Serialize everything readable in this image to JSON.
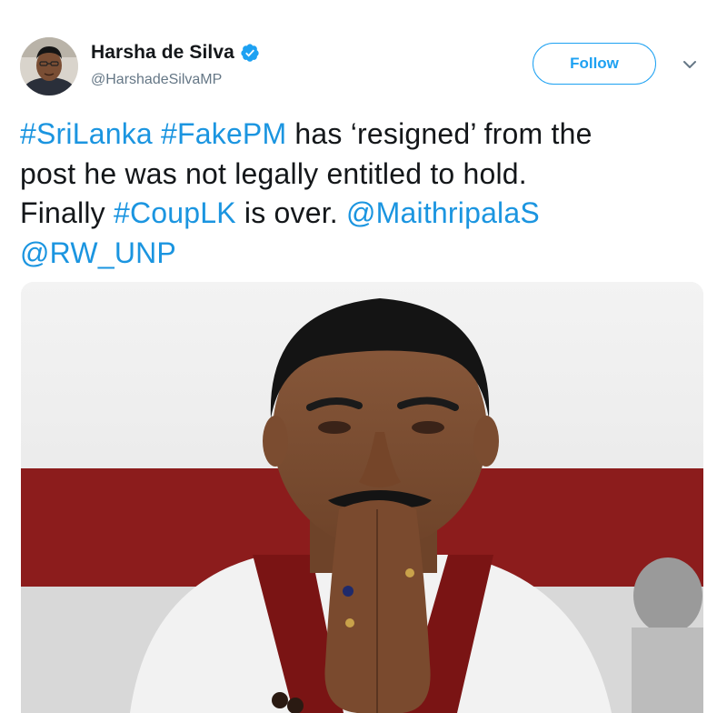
{
  "author": {
    "display_name": "Harsha de Silva",
    "handle": "@HarshadeSilvaMP",
    "verified": true,
    "avatar_icon": "avatar-photo"
  },
  "actions": {
    "follow_label": "Follow",
    "menu_icon": "chevron-down-icon"
  },
  "tweet": {
    "segments": {
      "l1_tag1": "#SriLanka",
      "l1_sp1": " ",
      "l1_tag2": "#FakePM",
      "l1_text": " has ‘resigned’ from the",
      "l2_text": "post he was not legally entitled to hold.",
      "l3_text1": "Finally ",
      "l3_tag": "#CoupLK",
      "l3_text2": " is over. ",
      "l3_mention": "@MaithripalaS",
      "l4_mention": "@RW_UNP"
    }
  },
  "media": {
    "description_icon": "photo-man-praying-hands",
    "colors": {
      "backdrop_red": "#8c1c1c",
      "shirt_white": "#f2f2f2",
      "shawl_maroon": "#7a1414"
    }
  },
  "colors": {
    "accent": "#1da1f2",
    "link": "#1b95e0",
    "text": "#14171a",
    "secondary": "#657786"
  }
}
